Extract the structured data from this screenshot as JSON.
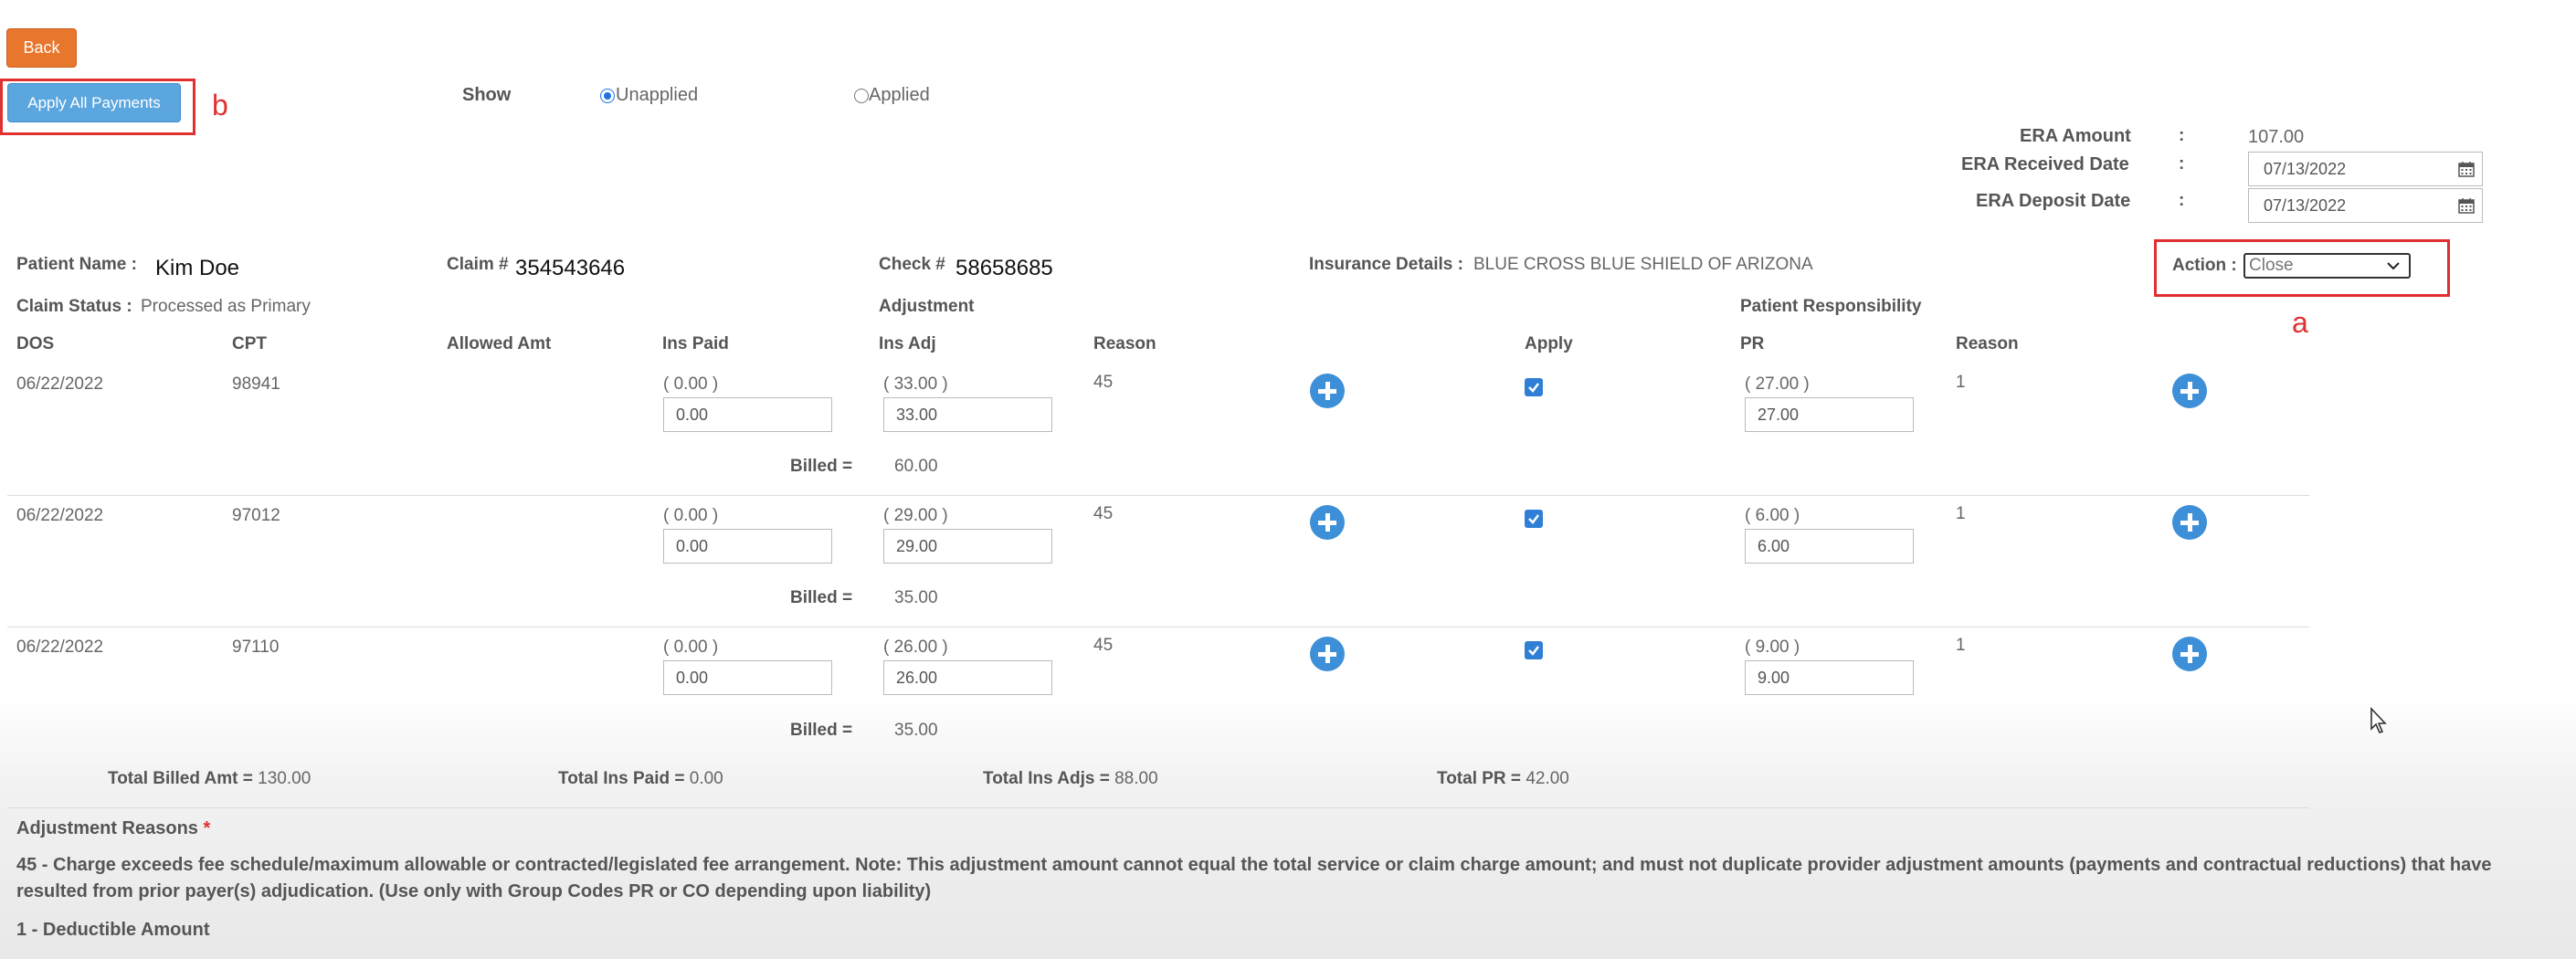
{
  "buttons": {
    "back": "Back",
    "apply_all": "Apply All Payments"
  },
  "annotations": {
    "a": "a",
    "b": "b"
  },
  "show": {
    "label": "Show",
    "options": [
      "Unapplied",
      "Applied"
    ],
    "selected": "Unapplied"
  },
  "era": {
    "amount_label": "ERA Amount",
    "amount": "107.00",
    "received_label": "ERA Received Date",
    "received": "07/13/2022",
    "deposit_label": "ERA Deposit Date",
    "deposit": "07/13/2022",
    "colon": ":"
  },
  "claim": {
    "patient_label": "Patient Name :",
    "patient": "Kim Doe",
    "claim_label": "Claim #",
    "claim_no": "354543646",
    "check_label": "Check #",
    "check_no": "58658685",
    "ins_label": "Insurance Details :",
    "ins": "BLUE CROSS BLUE SHIELD OF ARIZONA",
    "action_label": "Action :",
    "action_value": "Close",
    "status_label": "Claim Status :",
    "status": "Processed as Primary"
  },
  "groups": {
    "adjustment": "Adjustment",
    "patient_resp": "Patient Responsibility"
  },
  "columns": {
    "dos": "DOS",
    "cpt": "CPT",
    "allowed": "Allowed Amt",
    "ins_paid": "Ins Paid",
    "ins_adj": "Ins Adj",
    "reason": "Reason",
    "apply": "Apply",
    "pr": "PR",
    "reason2": "Reason"
  },
  "billed_label": "Billed =",
  "rows": [
    {
      "dos": "06/22/2022",
      "cpt": "98941",
      "ins_paid_orig": "( 0.00 )",
      "ins_paid": "0.00",
      "ins_adj_orig": "( 33.00 )",
      "ins_adj": "33.00",
      "reason": "45",
      "pr_orig": "( 27.00 )",
      "pr": "27.00",
      "pr_reason": "1",
      "billed": "60.00",
      "apply": true
    },
    {
      "dos": "06/22/2022",
      "cpt": "97012",
      "ins_paid_orig": "( 0.00 )",
      "ins_paid": "0.00",
      "ins_adj_orig": "( 29.00 )",
      "ins_adj": "29.00",
      "reason": "45",
      "pr_orig": "( 6.00 )",
      "pr": "6.00",
      "pr_reason": "1",
      "billed": "35.00",
      "apply": true
    },
    {
      "dos": "06/22/2022",
      "cpt": "97110",
      "ins_paid_orig": "( 0.00 )",
      "ins_paid": "0.00",
      "ins_adj_orig": "( 26.00 )",
      "ins_adj": "26.00",
      "reason": "45",
      "pr_orig": "( 9.00 )",
      "pr": "9.00",
      "pr_reason": "1",
      "billed": "35.00",
      "apply": true
    }
  ],
  "totals": {
    "billed_label": "Total Billed Amt =",
    "billed": "130.00",
    "ins_paid_label": "Total Ins Paid =",
    "ins_paid": "0.00",
    "ins_adj_label": "Total Ins Adjs =",
    "ins_adj": "88.00",
    "pr_label": "Total PR =",
    "pr": "42.00"
  },
  "reasons": {
    "title": "Adjustment Reasons",
    "required_mark": "*",
    "r45": "45 - Charge exceeds fee schedule/maximum allowable or contracted/legislated fee arrangement. Note: This adjustment amount cannot equal the total service or claim charge amount; and must not duplicate provider adjustment amounts (payments and contractual reductions) that have resulted from prior payer(s) adjudication. (Use only with Group Codes PR or CO depending upon liability)",
    "r1": "1 - Deductible Amount"
  },
  "colors": {
    "back": "#e8762d",
    "apply": "#5ba6df",
    "annotation": "#e03030",
    "accent": "#3d8fd8"
  }
}
